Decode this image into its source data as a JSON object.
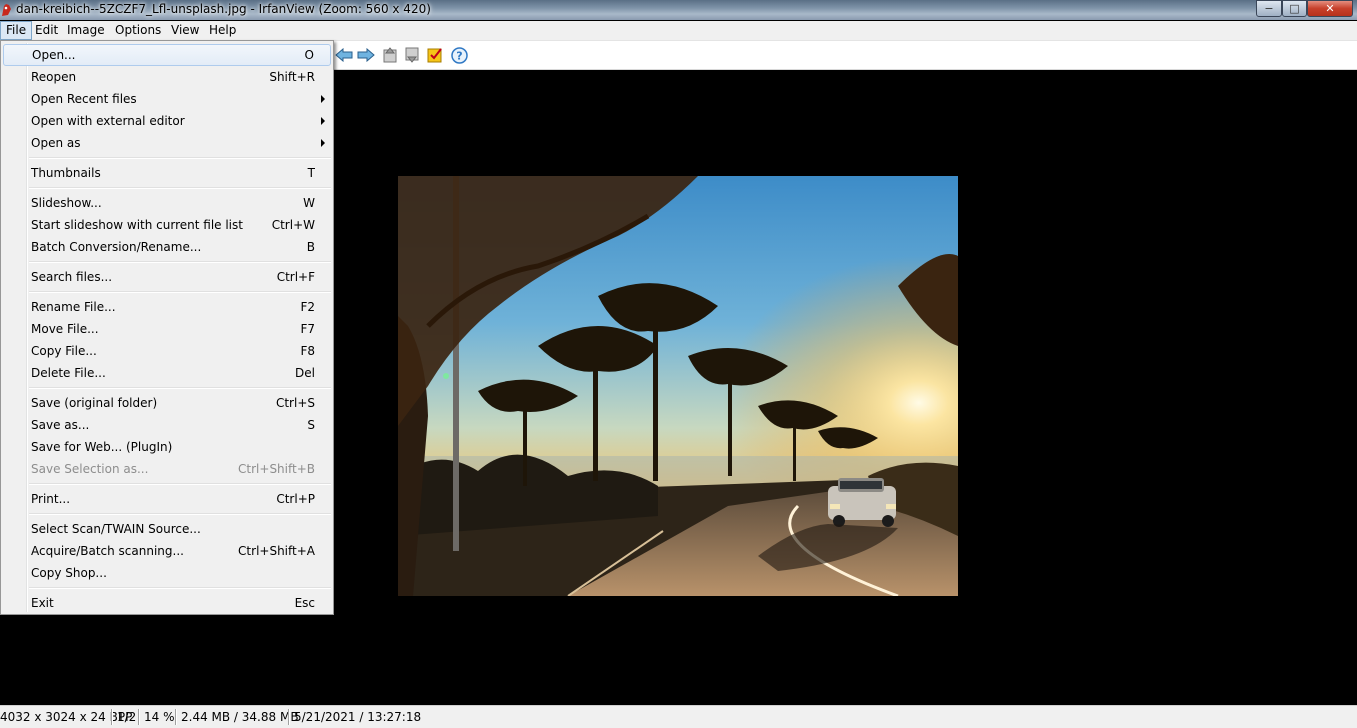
{
  "window": {
    "title": "dan-kreibich--5ZCZF7_Lfl-unsplash.jpg - IrfanView (Zoom: 560 x 420)",
    "minimize": "−",
    "maximize": "□",
    "close": "✕"
  },
  "menubar": {
    "items": [
      "File",
      "Edit",
      "Image",
      "Options",
      "View",
      "Help"
    ]
  },
  "toolbar": {
    "icons": [
      "back-arrow-icon",
      "forward-arrow-icon",
      "page-up-icon",
      "page-down-icon",
      "checklist-icon",
      "help-icon"
    ]
  },
  "file_menu": {
    "items": [
      {
        "label": "Open...",
        "shortcut": "O"
      },
      {
        "label": "Reopen",
        "shortcut": "Shift+R"
      },
      {
        "label": "Open Recent files",
        "shortcut": ""
      },
      {
        "label": "Open with external editor",
        "shortcut": ""
      },
      {
        "label": "Open as",
        "shortcut": ""
      },
      {
        "label": "Thumbnails",
        "shortcut": "T"
      },
      {
        "label": "Slideshow...",
        "shortcut": "W"
      },
      {
        "label": "Start slideshow with current file list",
        "shortcut": "Ctrl+W"
      },
      {
        "label": "Batch Conversion/Rename...",
        "shortcut": "B"
      },
      {
        "label": "Search files...",
        "shortcut": "Ctrl+F"
      },
      {
        "label": "Rename File...",
        "shortcut": "F2"
      },
      {
        "label": "Move File...",
        "shortcut": "F7"
      },
      {
        "label": "Copy File...",
        "shortcut": "F8"
      },
      {
        "label": "Delete File...",
        "shortcut": "Del"
      },
      {
        "label": "Save (original folder)",
        "shortcut": "Ctrl+S"
      },
      {
        "label": "Save as...",
        "shortcut": "S"
      },
      {
        "label": "Save for Web... (PlugIn)",
        "shortcut": ""
      },
      {
        "label": "Save Selection as...",
        "shortcut": "Ctrl+Shift+B"
      },
      {
        "label": "Print...",
        "shortcut": "Ctrl+P"
      },
      {
        "label": "Select Scan/TWAIN Source...",
        "shortcut": ""
      },
      {
        "label": "Acquire/Batch scanning...",
        "shortcut": "Ctrl+Shift+A"
      },
      {
        "label": "Copy Shop...",
        "shortcut": ""
      },
      {
        "label": "Exit",
        "shortcut": "Esc"
      }
    ]
  },
  "statusbar": {
    "dimensions": "4032 x 3024 x 24 BPP",
    "index": "1/2",
    "zoom": "14 %",
    "size": "2.44 MB / 34.88 MB",
    "datetime": "5/21/2021 / 13:27:18"
  },
  "colors": {
    "menu_bg": "#f0f0f0",
    "highlight": "#dbe8f5",
    "viewer_bg": "#000000"
  }
}
